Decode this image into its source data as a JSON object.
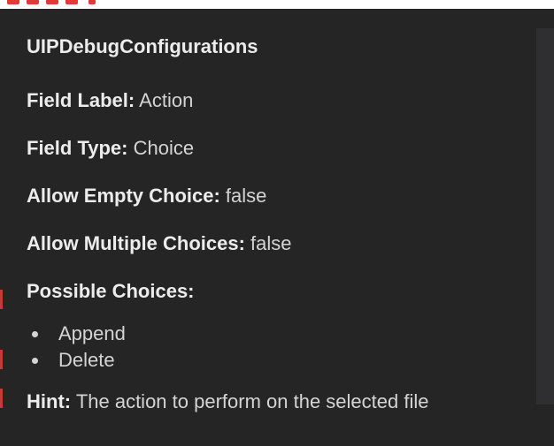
{
  "tooltip": {
    "title": "UIPDebugConfigurations",
    "fields": [
      {
        "key": "Field Label:",
        "value": "Action"
      },
      {
        "key": "Field Type:",
        "value": "Choice"
      },
      {
        "key": "Allow Empty Choice:",
        "value": "false"
      },
      {
        "key": "Allow Multiple Choices:",
        "value": "false"
      }
    ],
    "choices_label": "Possible Choices:",
    "choices": [
      "Append",
      "Delete"
    ],
    "hint": {
      "key": "Hint:",
      "value": "The action to perform on the selected file"
    }
  },
  "colors": {
    "background": "#252526",
    "text": "#d4d4d4",
    "accent_red": "#e03a3a"
  }
}
